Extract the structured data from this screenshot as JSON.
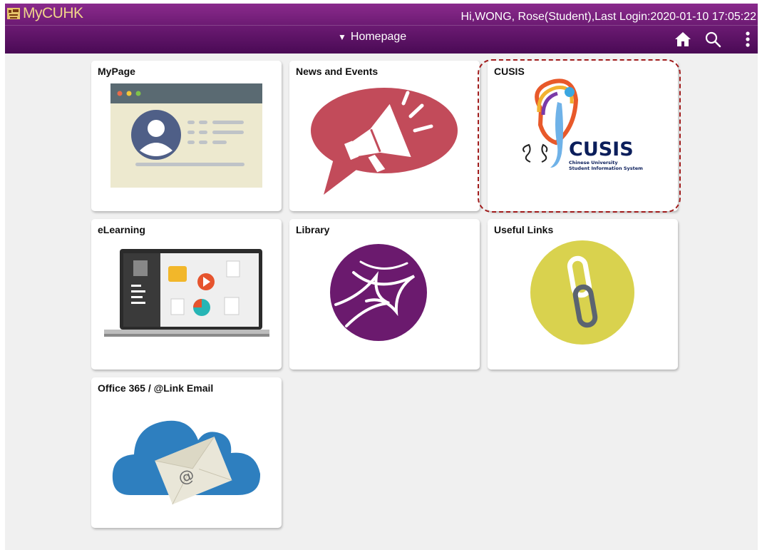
{
  "app": {
    "logo_text": "MyCUHK",
    "greeting": "Hi,WONG, Rose(Student),Last Login:2020-01-10 17:05:22",
    "nav_title": "Homepage",
    "caret": "▼",
    "icons": [
      "home-icon",
      "search-icon",
      "more-vertical-icon"
    ]
  },
  "tiles": [
    {
      "title": "MyPage"
    },
    {
      "title": "News and Events"
    },
    {
      "title": "CUSIS",
      "logo_word": "CUSIS",
      "logo_line1": "Chinese University",
      "logo_line2": "Student Information System"
    },
    {
      "title": "eLearning"
    },
    {
      "title": "Library"
    },
    {
      "title": "Useful Links"
    },
    {
      "title": "Office 365 / @Link Email",
      "glyph": "@"
    }
  ],
  "colors": {
    "header_top": "#8a2a8c",
    "header_bottom": "#4a0a55",
    "logo_gold": "#f0d48a",
    "background": "#f0f0f0",
    "highlight_border": "#a01b1b"
  }
}
